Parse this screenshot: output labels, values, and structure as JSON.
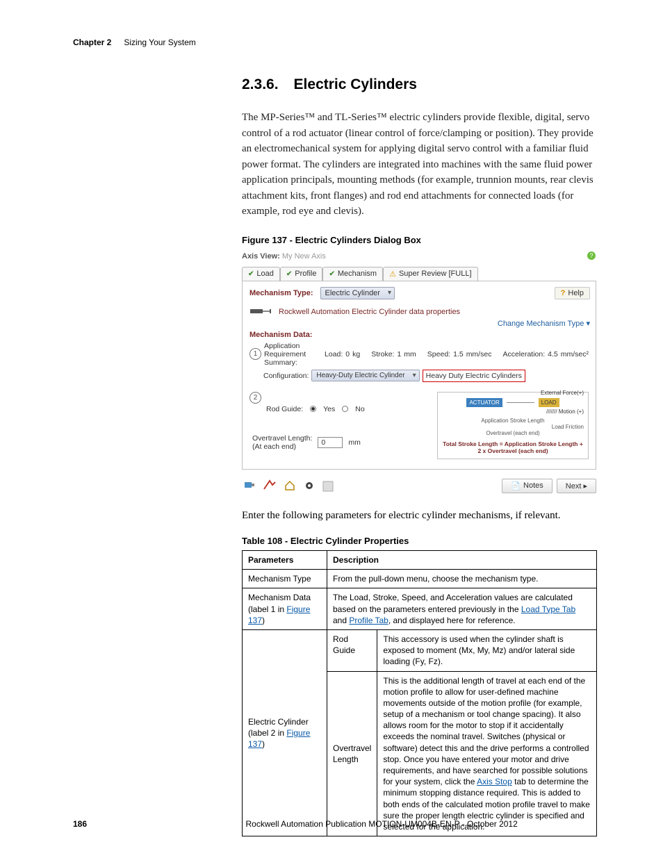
{
  "header": {
    "chapter": "Chapter 2",
    "title": "Sizing Your System"
  },
  "section": {
    "number": "2.3.6.",
    "title": "Electric Cylinders"
  },
  "para1": "The MP-Series™ and TL-Series™ electric cylinders provide flexible, digital, servo control of a rod actuator (linear control of force/clamping or position). They provide an electromechanical system for applying digital servo control with a familiar fluid power format. The cylinders are integrated into machines with the same fluid power application principals, mounting methods (for example, trunnion mounts, rear clevis attachment kits, front flanges) and rod end attachments for connected loads (for example, rod eye and clevis).",
  "figure_caption": "Figure 137 - Electric Cylinders Dialog Box",
  "ui": {
    "axis_view_label": "Axis View:",
    "axis_view_value": "My New Axis",
    "tabs": {
      "load": "Load",
      "profile": "Profile",
      "mechanism": "Mechanism",
      "review": "Super Review [FULL]"
    },
    "mechanism_type_label": "Mechanism Type:",
    "mechanism_type_value": "Electric Cylinder",
    "help_btn": "Help",
    "ra_desc": "Rockwell Automation Electric Cylinder data properties",
    "change_link": "Change Mechanism Type ▾",
    "mechanism_data_header": "Mechanism Data:",
    "ars": {
      "label": "Application Requirement Summary:",
      "load_lbl": "Load:",
      "load_val": "0",
      "load_unit": "kg",
      "stroke_lbl": "Stroke:",
      "stroke_val": "1",
      "stroke_unit": "mm",
      "speed_lbl": "Speed:",
      "speed_val": "1.5",
      "speed_unit": "mm/sec",
      "accel_lbl": "Acceleration:",
      "accel_val": "4.5",
      "accel_unit": "mm/sec²"
    },
    "config": {
      "lbl": "Configuration:",
      "combo": "Heavy-Duty Electric Cylinder",
      "btn": "Heavy Duty Electric Cylinders"
    },
    "rod": {
      "lbl": "Rod Guide:",
      "yes": "Yes",
      "no": "No"
    },
    "ot": {
      "lbl1": "Overtravel Length:",
      "lbl2": "(At each end)",
      "val": "0",
      "unit": "mm"
    },
    "diagram": {
      "actuator": "ACTUATOR",
      "load": "LOAD",
      "ext_force": "External Force(+)",
      "motion": "Motion (+)",
      "load_friction": "Load Friction",
      "app_stroke": "Application Stroke Length",
      "ot_each": "Overtravel (each end)",
      "note": "Total Stroke Length = Application Stroke Length + 2 x Overtravel (each end)"
    },
    "notes_btn": "Notes",
    "next_btn": "Next ▸"
  },
  "para2": "Enter the following parameters for electric cylinder mechanisms, if relevant.",
  "table_caption": "Table 108 - Electric Cylinder Properties",
  "table": {
    "hdr_params": "Parameters",
    "hdr_desc": "Description",
    "r1_param": "Mechanism Type",
    "r1_desc": "From the pull-down menu, choose the mechanism type.",
    "r2_param_a": "Mechanism Data",
    "r2_param_b_pre": "(label 1 in ",
    "r2_param_b_link": "Figure 137",
    "r2_param_b_post": ")",
    "r2_desc_pre": "The Load, Stroke, Speed, and Acceleration values are calculated based on the parameters entered previously in the ",
    "r2_link1": "Load Type Tab",
    "r2_mid": " and ",
    "r2_link2": "Profile Tab",
    "r2_desc_post": ", and displayed here for reference.",
    "r3_param_a": "Electric Cylinder",
    "r3_param_b_pre": "(label 2 in ",
    "r3_param_b_link": "Figure 137",
    "r3_param_b_post": ")",
    "r3_sub1": "Rod Guide",
    "r3_sub1_desc": "This accessory is used when the cylinder shaft is exposed to moment (Mx, My, Mz) and/or lateral side loading (Fy, Fz).",
    "r3_sub2": "Overtravel Length",
    "r3_sub2_desc_pre": "This is the additional length of travel at each end of the motion profile to allow for user-defined machine movements outside of the motion profile (for example, setup of a mechanism or tool change spacing). It also allows room for the motor to stop if it accidentally exceeds the nominal travel. Switches (physical or software) detect this and the drive performs a controlled stop. Once you have entered your motor and drive requirements, and have searched for possible solutions for your system, click the ",
    "r3_sub2_link": "Axis Stop",
    "r3_sub2_desc_post": " tab to determine the minimum stopping distance required. This is added to both ends of the calculated motion profile travel to make sure the proper length electric cylinder is specified and selected for the application."
  },
  "footer": {
    "page": "186",
    "pub": "Rockwell Automation Publication MOTION-UM004B-EN-P - October 2012"
  }
}
